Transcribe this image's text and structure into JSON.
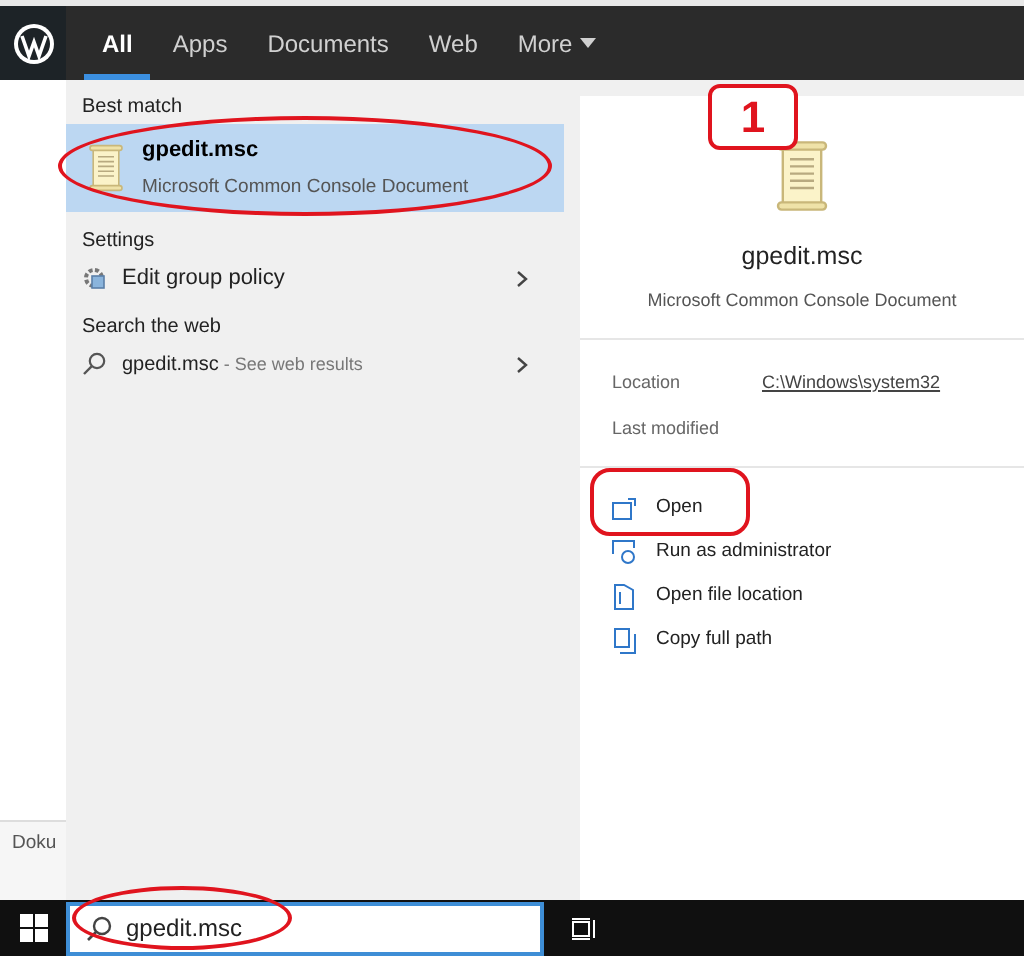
{
  "background": {
    "doc_label": "Doku"
  },
  "tabs": [
    {
      "label": "All",
      "selected": true,
      "kind": "tab"
    },
    {
      "label": "Apps",
      "selected": false,
      "kind": "tab"
    },
    {
      "label": "Documents",
      "selected": false,
      "kind": "tab"
    },
    {
      "label": "Web",
      "selected": false,
      "kind": "tab"
    },
    {
      "label": "More",
      "selected": false,
      "kind": "menu"
    }
  ],
  "results": [
    {
      "heading": "Best match",
      "items": [
        {
          "kind": "app",
          "title": "gpedit.msc",
          "subtitle": "Microsoft Common Console Document",
          "selected": true,
          "circled": true
        }
      ]
    },
    {
      "heading": "Settings",
      "items": [
        {
          "kind": "setting",
          "title": "Edit group policy",
          "selected": false,
          "circled": false
        }
      ]
    },
    {
      "heading": "Search the web",
      "items": [
        {
          "kind": "web",
          "title": "gpedit.msc",
          "hint": "- See web results",
          "selected": false,
          "circled": false
        }
      ]
    }
  ],
  "preview": {
    "step": "1",
    "title": "gpedit.msc",
    "subtitle": "Microsoft Common Console Document",
    "details": [
      {
        "label": "Location",
        "value": "C:\\Windows\\system32"
      },
      {
        "label": "Last modified"
      }
    ],
    "actions": [
      {
        "kind": "open",
        "label": "Open",
        "circled": true
      },
      {
        "kind": "admin",
        "label": "Run as administrator",
        "circled": false
      },
      {
        "kind": "folder",
        "label": "Open file location",
        "circled": false
      },
      {
        "kind": "copy",
        "label": "Copy full path",
        "circled": false
      }
    ]
  },
  "search_box": {
    "value": "gpedit.msc",
    "circled": true
  }
}
